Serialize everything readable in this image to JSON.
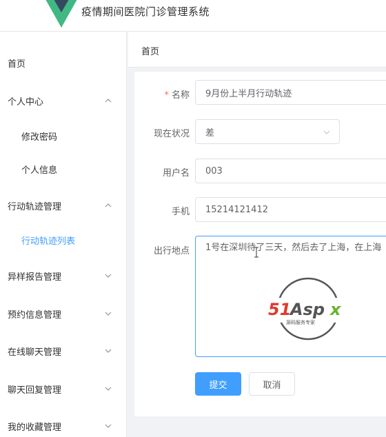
{
  "app": {
    "title": "疫情期间医院门诊管理系统"
  },
  "sidebar": {
    "items": [
      {
        "label": "首页"
      },
      {
        "label": "个人中心"
      },
      {
        "label": "修改密码"
      },
      {
        "label": "个人信息"
      },
      {
        "label": "行动轨迹管理"
      },
      {
        "label": "行动轨迹列表"
      },
      {
        "label": "异样报告管理"
      },
      {
        "label": "预约信息管理"
      },
      {
        "label": "在线聊天管理"
      },
      {
        "label": "聊天回复管理"
      },
      {
        "label": "我的收藏管理"
      }
    ]
  },
  "breadcrumb": {
    "home": "首页"
  },
  "form": {
    "name": {
      "label": "名称",
      "required_mark": "*",
      "value": "9月份上半月行动轨迹"
    },
    "status": {
      "label": "现在状况",
      "value": "差"
    },
    "username": {
      "label": "用户名",
      "value": "003"
    },
    "phone": {
      "label": "手机",
      "value": "15214121412"
    },
    "places": {
      "label": "出行地点",
      "value": "1号在深圳待了三天，然后去了上海，在上海"
    },
    "submit_label": "提交",
    "cancel_label": "取消"
  },
  "watermark": {
    "brand": "51Aspx",
    "tagline": "源码服务专家"
  },
  "colors": {
    "primary": "#409eff",
    "logo_green": "#41b883",
    "logo_dark": "#35495e",
    "watermark_red": "#e03a2f",
    "watermark_green": "#6ab42d"
  }
}
